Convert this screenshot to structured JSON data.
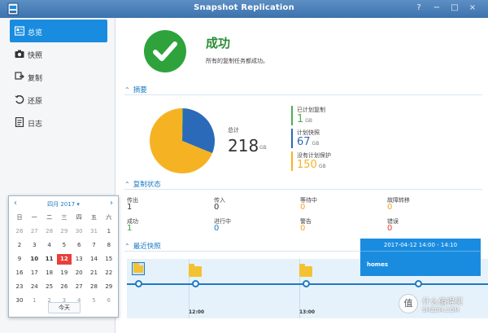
{
  "window": {
    "title": "Snapshot Replication",
    "controls": [
      "?",
      "−",
      "□",
      "×"
    ]
  },
  "sidebar": {
    "items": [
      {
        "label": "总览",
        "icon": "overview-icon",
        "active": true
      },
      {
        "label": "快照",
        "icon": "camera-icon",
        "active": false
      },
      {
        "label": "复制",
        "icon": "replication-icon",
        "active": false
      },
      {
        "label": "还原",
        "icon": "restore-icon",
        "active": false
      },
      {
        "label": "日志",
        "icon": "log-icon",
        "active": false
      }
    ]
  },
  "status": {
    "title": "成功",
    "description": "所有的复制任务都成功。"
  },
  "summary": {
    "heading": "摘要",
    "total_label": "总计",
    "total_value": "218",
    "total_unit": "GB",
    "legend": [
      {
        "label": "已计划复制",
        "value": "1",
        "unit": "GB",
        "color": "#4caf50"
      },
      {
        "label": "计划快照",
        "value": "67",
        "unit": "GB",
        "color": "#2a6ab8"
      },
      {
        "label": "没有计划保护",
        "value": "150",
        "unit": "GB",
        "color": "#f5b324"
      }
    ],
    "pie": [
      {
        "label": "已计划复制",
        "value": 1,
        "color": "#4caf50"
      },
      {
        "label": "计划快照",
        "value": 67,
        "color": "#2a6ab8"
      },
      {
        "label": "没有计划保护",
        "value": 150,
        "color": "#f5b324"
      }
    ]
  },
  "replication_status": {
    "heading": "复制状态",
    "cells": [
      {
        "label": "传出",
        "value": "1",
        "color": "#333333"
      },
      {
        "label": "传入",
        "value": "0",
        "color": "#333333"
      },
      {
        "label": "等待中",
        "value": "0",
        "color": "#f5a623"
      },
      {
        "label": "故障转移",
        "value": "0",
        "color": "#f5a623"
      },
      {
        "label": "成功",
        "value": "1",
        "color": "#2ea33c"
      },
      {
        "label": "进行中",
        "value": "0",
        "color": "#1e7bc4"
      },
      {
        "label": "警告",
        "value": "0",
        "color": "#f5a623"
      },
      {
        "label": "错误",
        "value": "0",
        "color": "#e8403a"
      }
    ]
  },
  "recent_snapshots": {
    "heading": "最近快照",
    "tick_labels": [
      "12:00",
      "13:00"
    ]
  },
  "tooltip": {
    "time": "2017-04-12  14:00 - 14:10",
    "name": "homes"
  },
  "calendar": {
    "month_label": "四月 2017 ▾",
    "prev": "‹",
    "next": "›",
    "weekdays": [
      "日",
      "一",
      "二",
      "三",
      "四",
      "五",
      "六"
    ],
    "weeks": [
      [
        "26",
        "27",
        "28",
        "29",
        "30",
        "31",
        "1"
      ],
      [
        "2",
        "3",
        "4",
        "5",
        "6",
        "7",
        "8"
      ],
      [
        "9",
        "10",
        "11",
        "12",
        "13",
        "14",
        "15"
      ],
      [
        "16",
        "17",
        "18",
        "19",
        "20",
        "21",
        "22"
      ],
      [
        "23",
        "24",
        "25",
        "26",
        "27",
        "28",
        "29"
      ],
      [
        "30",
        "1",
        "2",
        "3",
        "4",
        "5",
        "6"
      ]
    ],
    "current_month_rows": [
      [
        6
      ],
      [],
      [],
      [],
      [],
      [
        0
      ]
    ],
    "bold_days": [
      "10",
      "11"
    ],
    "today": "12",
    "today_button": "今天"
  },
  "watermark": {
    "logo": "值",
    "text": "什么值得买",
    "sub": "SMZDM.COM"
  }
}
